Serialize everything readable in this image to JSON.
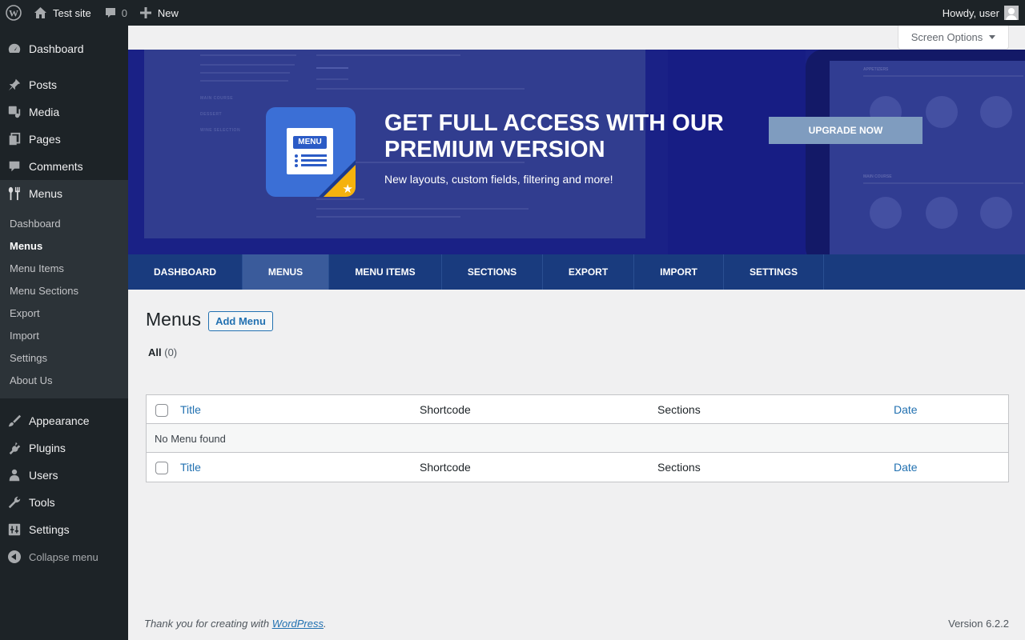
{
  "admin_bar": {
    "site_name": "Test site",
    "comments_count": "0",
    "new_label": "New",
    "greeting": "Howdy, user"
  },
  "sidebar": {
    "items_top": [
      {
        "label": "Dashboard",
        "icon": "dashboard-icon"
      }
    ],
    "items_main": [
      {
        "label": "Posts",
        "icon": "pin-icon"
      },
      {
        "label": "Media",
        "icon": "media-icon"
      },
      {
        "label": "Pages",
        "icon": "pages-icon"
      },
      {
        "label": "Comments",
        "icon": "comment-icon"
      },
      {
        "label": "Menus",
        "icon": "fork-knife-icon"
      }
    ],
    "submenu": [
      {
        "label": "Dashboard"
      },
      {
        "label": "Menus",
        "active": true
      },
      {
        "label": "Menu Items"
      },
      {
        "label": "Menu Sections"
      },
      {
        "label": "Export"
      },
      {
        "label": "Import"
      },
      {
        "label": "Settings"
      },
      {
        "label": "About Us"
      }
    ],
    "items_bottom": [
      {
        "label": "Appearance",
        "icon": "brush-icon"
      },
      {
        "label": "Plugins",
        "icon": "plug-icon"
      },
      {
        "label": "Users",
        "icon": "user-icon"
      },
      {
        "label": "Tools",
        "icon": "wrench-icon"
      },
      {
        "label": "Settings",
        "icon": "settings-icon"
      }
    ],
    "collapse_label": "Collapse menu"
  },
  "screen_options": {
    "label": "Screen Options"
  },
  "banner": {
    "logo_text": "MENU",
    "title": "GET FULL ACCESS WITH OUR PREMIUM VERSION",
    "subtitle": "New layouts, custom fields, filtering and more!",
    "cta_label": "UPGRADE NOW"
  },
  "tabs": [
    {
      "label": "DASHBOARD"
    },
    {
      "label": "MENUS",
      "active": true
    },
    {
      "label": "MENU ITEMS"
    },
    {
      "label": "SECTIONS"
    },
    {
      "label": "EXPORT"
    },
    {
      "label": "IMPORT"
    },
    {
      "label": "SETTINGS"
    }
  ],
  "main": {
    "title": "Menus",
    "add_button": "Add Menu",
    "filter_label": "All",
    "filter_count": "(0)"
  },
  "table": {
    "columns": [
      "Title",
      "Shortcode",
      "Sections",
      "Date"
    ],
    "empty_message": "No Menu found"
  },
  "footer": {
    "thanks_prefix": "Thank you for creating with ",
    "thanks_link": "WordPress",
    "thanks_suffix": ".",
    "version": "Version 6.2.2"
  },
  "colors": {
    "admin_dark": "#1d2327",
    "link_blue": "#2271b1",
    "tab_bar": "#193b7e",
    "banner_bg": "#1a1f8e",
    "upgrade_button": "#7f9cbf",
    "logo_blue": "#3b6fd6",
    "logo_accent": "#f5b20e"
  }
}
